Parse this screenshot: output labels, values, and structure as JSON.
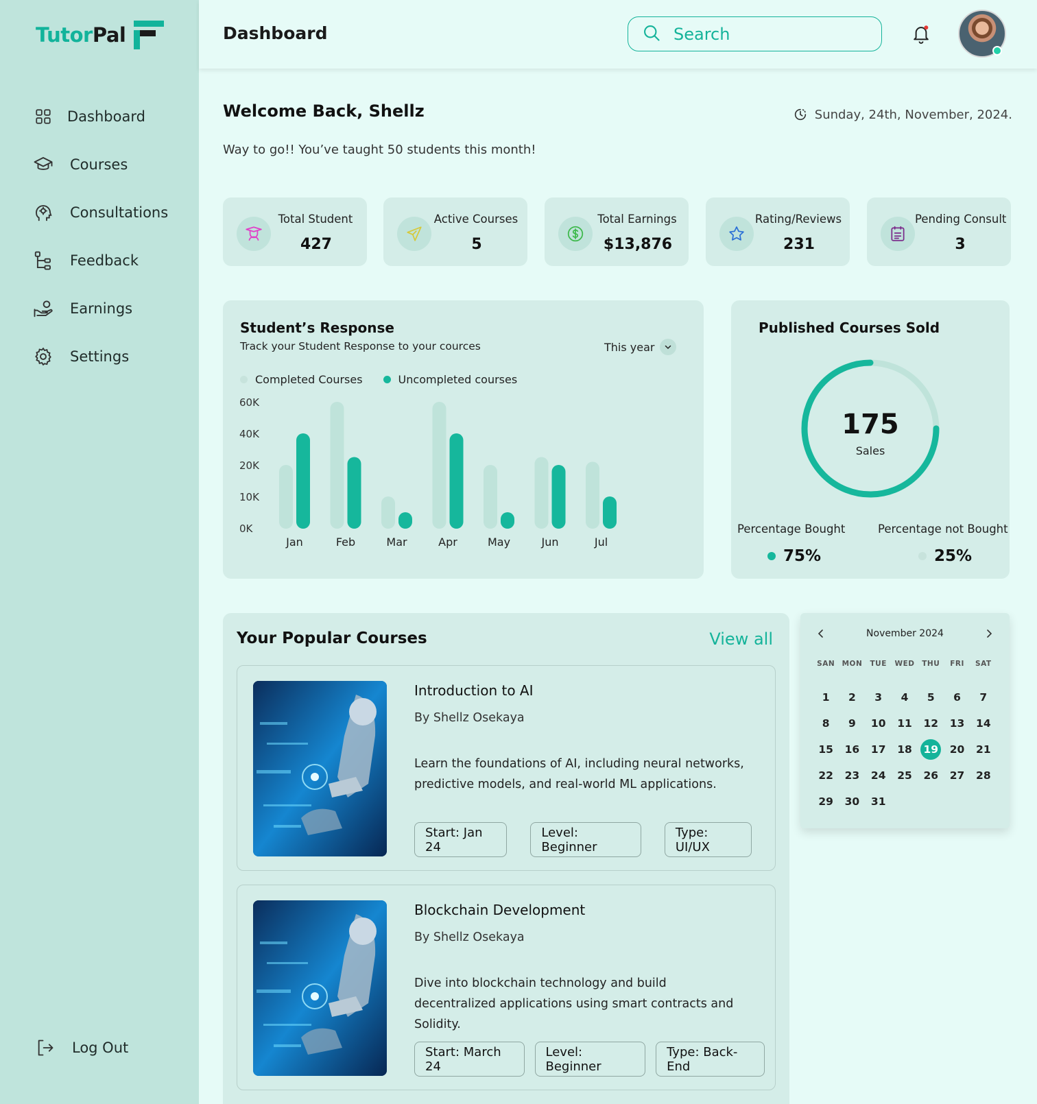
{
  "brand": {
    "name_part1": "Tutor",
    "name_part2": "Pal"
  },
  "sidebar": {
    "items": [
      {
        "label": "Dashboard",
        "icon": "grid-icon"
      },
      {
        "label": "Courses",
        "icon": "graduation-cap-icon"
      },
      {
        "label": "Consultations",
        "icon": "head-brain-icon"
      },
      {
        "label": "Feedback",
        "icon": "hierarchy-icon"
      },
      {
        "label": "Earnings",
        "icon": "hand-coins-icon"
      },
      {
        "label": "Settings",
        "icon": "gear-icon"
      }
    ],
    "logout": "Log Out"
  },
  "header": {
    "title": "Dashboard",
    "search_placeholder": "Search"
  },
  "welcome": {
    "heading": "Welcome Back, Shellz",
    "subtitle": "Way to go!! You’ve taught 50 students this month!",
    "date": "Sunday, 24th, November, 2024."
  },
  "stats": [
    {
      "label": "Total Student",
      "value": "427",
      "icon": "student-icon",
      "color": "#e040c8"
    },
    {
      "label": "Active Courses",
      "value": "5",
      "icon": "airplane-icon",
      "color": "#d6c93a"
    },
    {
      "label": "Total Earnings",
      "value": "$13,876",
      "icon": "dollar-icon",
      "color": "#3cb84a"
    },
    {
      "label": "Rating/Reviews",
      "value": "231",
      "icon": "star-icon",
      "color": "#2a6fd6"
    },
    {
      "label": "Pending Consult",
      "value": "3",
      "icon": "calendar-note-icon",
      "color": "#7a2a8a"
    }
  ],
  "response_chart": {
    "title": "Student’s Response",
    "subtitle": "Track your Student Response to your cources",
    "period": "This year",
    "colors": {
      "completed": "#bfe3da",
      "uncompleted": "#16b79c"
    }
  },
  "chart_data": {
    "type": "bar",
    "categories": [
      "Jan",
      "Feb",
      "Mar",
      "Apr",
      "May",
      "Jun",
      "Jul"
    ],
    "series": [
      {
        "name": "Completed Courses",
        "values": [
          20000,
          60000,
          10000,
          60000,
          20000,
          25000,
          22000
        ]
      },
      {
        "name": "Uncompleted courses",
        "values": [
          40000,
          25000,
          5000,
          40000,
          5000,
          20000,
          10000
        ]
      }
    ],
    "yticks": [
      "60K",
      "40K",
      "20K",
      "10K",
      "0K"
    ],
    "ytick_values": [
      60000,
      40000,
      20000,
      10000,
      0
    ],
    "ylim": [
      0,
      60000
    ],
    "legend": "top-left",
    "grid": false
  },
  "sold": {
    "title": "Published Courses Sold",
    "value": "175",
    "caption": "Sales",
    "bought_label": "Percentage Bought",
    "bought_value": "75%",
    "bought_fraction": 0.75,
    "not_bought_label": "Percentage not Bought",
    "not_bought_value": "25%",
    "colors": {
      "bought": "#16b79c",
      "not_bought": "#bfe3da"
    }
  },
  "courses": {
    "title": "Your Popular Courses",
    "view_all": "View all",
    "items": [
      {
        "title": "Introduction to AI",
        "author": "By Shellz Osekaya",
        "description": "Learn the foundations of AI, including neural networks, predictive models, and real-world ML applications.",
        "tags": [
          "Start: Jan 24",
          "Level: Beginner",
          "Type: UI/UX"
        ]
      },
      {
        "title": "Blockchain Development",
        "author": "By Shellz Osekaya",
        "description": "Dive into blockchain technology and build decentralized applications using smart contracts and Solidity.",
        "tags": [
          "Start: March 24",
          "Level: Beginner",
          "Type: Back-End"
        ]
      }
    ]
  },
  "calendar": {
    "month": "November 2024",
    "weekdays": [
      "SAN",
      "MON",
      "TUE",
      "WED",
      "THU",
      "FRI",
      "SAT"
    ],
    "weeks": [
      [
        "1",
        "2",
        "3",
        "4",
        "5",
        "6",
        "7"
      ],
      [
        "8",
        "9",
        "10",
        "11",
        "12",
        "13",
        "14"
      ],
      [
        "15",
        "16",
        "17",
        "18",
        "19",
        "20",
        "21"
      ],
      [
        "22",
        "23",
        "24",
        "25",
        "26",
        "27",
        "28"
      ],
      [
        "29",
        "30",
        "31",
        "",
        "",
        "",
        ""
      ]
    ],
    "selected": "19"
  }
}
